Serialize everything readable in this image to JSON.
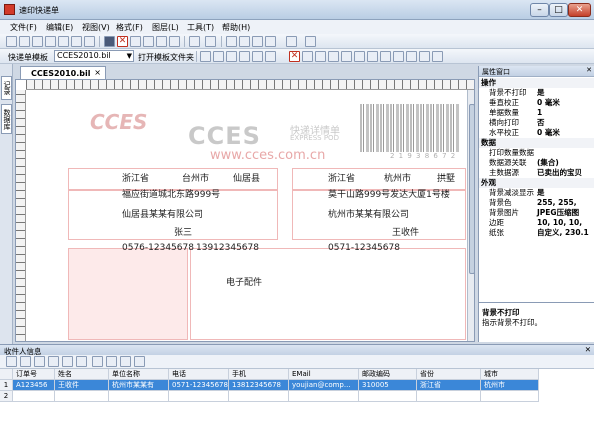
{
  "window": {
    "title": "速印快递单"
  },
  "menu": [
    "文件(F)",
    "编辑(E)",
    "视图(V)",
    "格式(F)",
    "图层(L)",
    "工具(T)",
    "帮助(H)"
  ],
  "toolbar2": {
    "template_label": "快递单模板",
    "template_value": "CCES2010.bil",
    "open_folder": "打开模板文件夹"
  },
  "left_tabs": [
    "记录",
    "数据库"
  ],
  "doc_tab": {
    "label": "CCES2010.bil",
    "close": "×"
  },
  "form": {
    "logo": "CCES",
    "brand": "CCES",
    "brand_sub1": "快递详情单",
    "brand_sub2": "EXPRESS POD",
    "website": "www.cces.com.cn",
    "barcode_number": "2 1 9 3 8 6 7 2",
    "sender_province": "浙江省",
    "sender_city": "台州市",
    "sender_county": "仙居县",
    "sender_address": "福应街道城北东路999号",
    "sender_company": "仙居县某某有限公司",
    "sender_name": "张三",
    "sender_phone": "0576-12345678",
    "sender_mobile": "13912345678",
    "recv_province": "浙江省",
    "recv_city": "杭州市",
    "recv_district": "拱墅",
    "recv_address": "莫干山路999号发达大厦1号楼",
    "recv_company": "杭州市某某有限公司",
    "recv_name": "王收件",
    "recv_phone": "0571-12345678",
    "item": "电子配件"
  },
  "props": {
    "title": "属性窗口",
    "rows": [
      {
        "cat": "操作"
      },
      {
        "k": "背景不打印",
        "v": "是"
      },
      {
        "k": "垂直校正",
        "v": "0 毫米"
      },
      {
        "k": "单据数量",
        "v": "1"
      },
      {
        "k": "横向打印",
        "v": "否"
      },
      {
        "k": "水平校正",
        "v": "0 毫米"
      },
      {
        "cat": "数据"
      },
      {
        "k": "打印数量数据",
        "v": ""
      },
      {
        "k": "数据源关联",
        "v": "(集合)"
      },
      {
        "k": "主数据源",
        "v": "已卖出的宝贝"
      },
      {
        "cat": "外观"
      },
      {
        "k": "背景减淡显示",
        "v": "是"
      },
      {
        "k": "背景色",
        "v": "255, 255,"
      },
      {
        "k": "背景图片",
        "v": "JPEG压缩图"
      },
      {
        "k": "边距",
        "v": "10, 10, 10,"
      },
      {
        "k": "纸张",
        "v": "自定义, 230.1"
      }
    ],
    "desc_title": "背景不打印",
    "desc_text": "指示背景不打印。"
  },
  "bottom": {
    "title": "收件人信息",
    "columns": [
      "订单号",
      "姓名",
      "单位名称",
      "电话",
      "手机",
      "EMail",
      "邮政编码",
      "省份",
      "城市"
    ],
    "rows": [
      {
        "n": "1",
        "cells": [
          "A123456",
          "王收件",
          "杭州市某某有",
          "0571-12345678",
          "13812345678",
          "youjian@comp...",
          "310005",
          "浙江省",
          "杭州市"
        ]
      },
      {
        "n": "2",
        "cells": [
          "",
          "",
          "",
          "",
          "",
          "",
          "",
          "",
          ""
        ]
      }
    ]
  }
}
